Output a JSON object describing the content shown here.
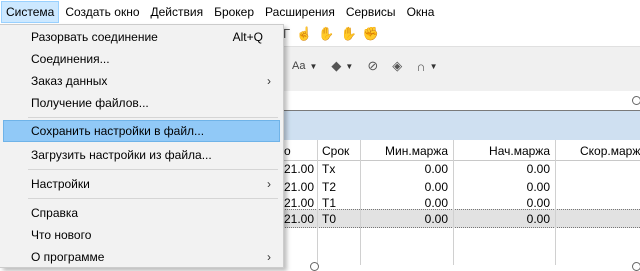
{
  "menubar": {
    "items": [
      "Система",
      "Создать окно",
      "Действия",
      "Брокер",
      "Расширения",
      "Сервисы",
      "Окна"
    ]
  },
  "dropdown": {
    "items": [
      {
        "label": "Разорвать соединение",
        "shortcut": "Alt+Q"
      },
      {
        "label": "Соединения..."
      },
      {
        "label": "Заказ данных",
        "submenu": "›"
      },
      {
        "label": "Получение файлов..."
      },
      {
        "label": "Сохранить настройки в файл..."
      },
      {
        "label": "Загрузить настройки из файла..."
      },
      {
        "label": "Настройки",
        "submenu": "›"
      },
      {
        "label": "Справка"
      },
      {
        "label": "Что нового"
      },
      {
        "label": "О программе",
        "submenu": "›"
      }
    ],
    "highlighted_index": 4
  },
  "toolbar": {
    "aa_label": "Aa"
  },
  "table": {
    "columns": [
      "о",
      "Срок",
      "Мин.маржа",
      "Нач.маржа",
      "Скор.марж"
    ],
    "rows": [
      {
        "a": "21.00",
        "b": "Tx",
        "c": "0.00",
        "d": "0.00"
      },
      {
        "a": "21.00",
        "b": "T2",
        "c": "0.00",
        "d": "0.00"
      },
      {
        "a": "21.00",
        "b": "T1",
        "c": "0.00",
        "d": "0.00"
      },
      {
        "a": "21.00",
        "b": "T0",
        "c": "0.00",
        "d": "0.00"
      }
    ],
    "selected_row": 3
  },
  "colors": {
    "menu_highlight": "#91c9f7",
    "menubar_active": "#cce8ff",
    "panel_header": "#cfe0f1"
  }
}
